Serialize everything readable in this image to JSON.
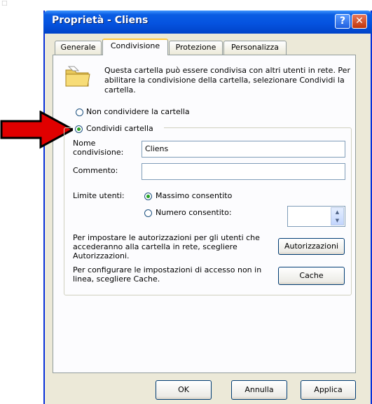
{
  "window": {
    "title": "Proprietà - Cliens",
    "help_glyph": "?",
    "close_glyph": "✕"
  },
  "tabs": [
    "Generale",
    "Condivisione",
    "Protezione",
    "Personalizza"
  ],
  "description": "Questa cartella può essere condivisa con altri utenti in rete. Per abilitare la condivisione della cartella, selezionare Condividi la cartella.",
  "sharing": {
    "option_no_share": "Non condividere la cartella",
    "option_share": "Condividi cartella",
    "selected": "share"
  },
  "share_name": {
    "label_line1": "Nome",
    "label_line2": "condivisione:",
    "value": "Cliens"
  },
  "comment": {
    "label": "Commento:",
    "value": ""
  },
  "user_limit": {
    "label": "Limite utenti:",
    "option_max": "Massimo consentito",
    "option_number": "Numero consentito:",
    "selected": "max",
    "count_value": ""
  },
  "permissions": {
    "text": "Per impostare le autorizzazioni per gli utenti che accederanno alla cartella in rete, scegliere Autorizzazioni.",
    "button": "Autorizzazioni"
  },
  "cache": {
    "text": "Per configurare le impostazioni di accesso non in linea, scegliere Cache.",
    "button": "Cache"
  },
  "footer": {
    "ok": "OK",
    "cancel": "Annulla",
    "apply": "Applica"
  },
  "icons": {
    "folder": "shared-folder-icon",
    "arrow": "red-arrow-annotation"
  },
  "colors": {
    "titlebar": "#0553e0",
    "window_bg": "#ece9d8",
    "arrow": "#e00000",
    "active_tab_highlight": "#ffc83c"
  }
}
